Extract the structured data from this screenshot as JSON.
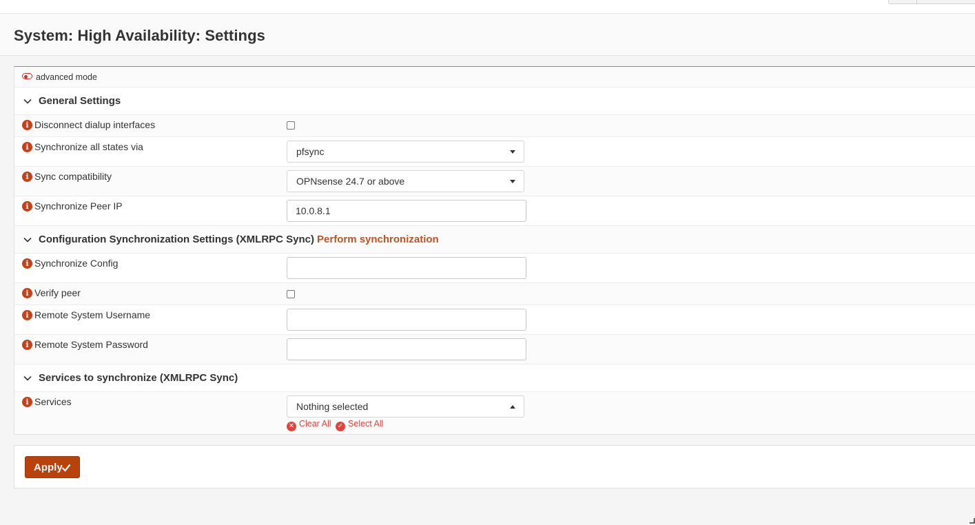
{
  "page": {
    "title": "System: High Availability: Settings"
  },
  "advanced_mode": {
    "label": "advanced mode",
    "enabled": false
  },
  "sections": {
    "general": {
      "title": "General Settings"
    },
    "config_sync": {
      "title": "Configuration Synchronization Settings (XMLRPC Sync)",
      "action_link": "Perform synchronization"
    },
    "services_sync": {
      "title": "Services to synchronize (XMLRPC Sync)"
    }
  },
  "fields": {
    "disconnect_dialup": {
      "label": "Disconnect dialup interfaces",
      "checked": false
    },
    "sync_states_via": {
      "label": "Synchronize all states via",
      "value": "pfsync"
    },
    "sync_compat": {
      "label": "Sync compatibility",
      "value": "OPNsense 24.7 or above"
    },
    "sync_peer_ip": {
      "label": "Synchronize Peer IP",
      "value": "10.0.8.1"
    },
    "sync_config": {
      "label": "Synchronize Config",
      "value": ""
    },
    "verify_peer": {
      "label": "Verify peer",
      "checked": false
    },
    "remote_username": {
      "label": "Remote System Username",
      "value": ""
    },
    "remote_password": {
      "label": "Remote System Password",
      "value": ""
    },
    "services": {
      "label": "Services",
      "value": "Nothing selected",
      "clear_all": "Clear All",
      "select_all": "Select All"
    }
  },
  "actions": {
    "apply_label": "Apply"
  },
  "colors": {
    "accent": "#c0431b",
    "apply_button": "#b8410c",
    "link_red": "#e0443c"
  }
}
